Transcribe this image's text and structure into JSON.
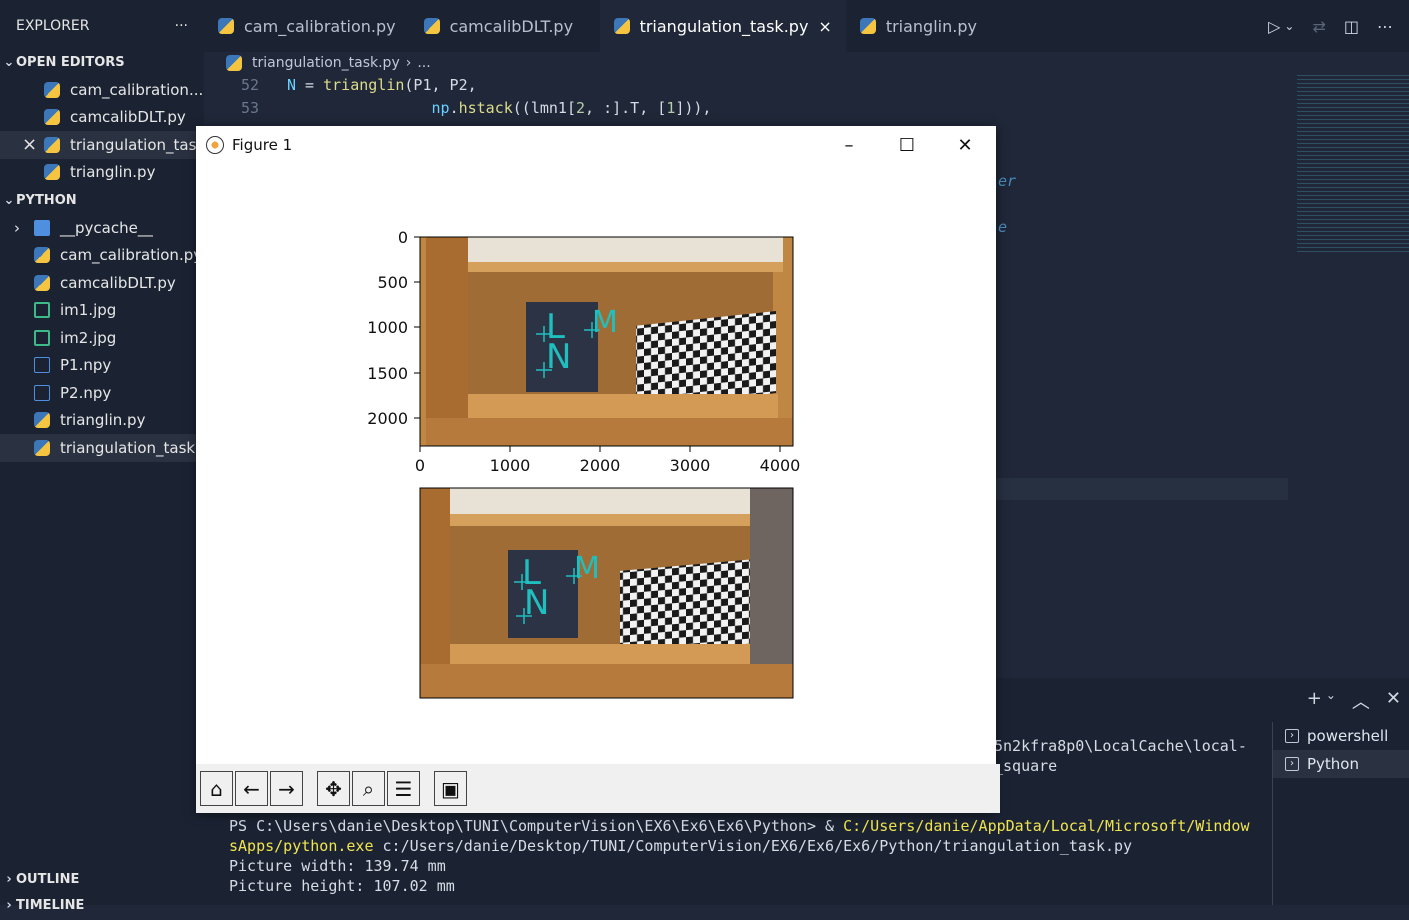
{
  "explorer": {
    "title": "EXPLORER",
    "more": "···",
    "open_editors_title": "OPEN EDITORS",
    "open_editors": [
      {
        "label": "cam_calibration....",
        "icon": "python-icon"
      },
      {
        "label": "camcalibDLT.py",
        "icon": "python-icon"
      },
      {
        "label": "triangulation_tas...",
        "icon": "python-icon",
        "close": "×"
      },
      {
        "label": "trianglin.py",
        "icon": "python-icon"
      }
    ],
    "folder_title": "PYTHON",
    "files": [
      {
        "label": "__pycache__",
        "icon": "folder-icon"
      },
      {
        "label": "cam_calibration.py",
        "icon": "python-icon"
      },
      {
        "label": "camcalibDLT.py",
        "icon": "python-icon"
      },
      {
        "label": "im1.jpg",
        "icon": "image-icon"
      },
      {
        "label": "im2.jpg",
        "icon": "image-icon"
      },
      {
        "label": "P1.npy",
        "icon": "file-icon"
      },
      {
        "label": "P2.npy",
        "icon": "file-icon"
      },
      {
        "label": "trianglin.py",
        "icon": "python-icon"
      },
      {
        "label": "triangulation_task...",
        "icon": "python-icon"
      }
    ],
    "outline": "OUTLINE",
    "timeline": "TIMELINE"
  },
  "tabs": [
    {
      "label": "cam_calibration.py"
    },
    {
      "label": "camcalibDLT.py"
    },
    {
      "label": "triangulation_task.py",
      "close": "×"
    },
    {
      "label": "trianglin.py"
    }
  ],
  "breadcrumb": {
    "file": "triangulation_task.py",
    "rest": "..."
  },
  "code": {
    "line52_num": "52",
    "line52_var": "N",
    "line52_eq": " = ",
    "line52_fn": "trianglin",
    "line52_args": "(P1, P2,",
    "line53_num": "53",
    "line53_mod": "np",
    "line53_dot": ".",
    "line53_fn": "hstack",
    "line53_rest_a": "((lmn1[",
    "line53_n2": "2",
    "line53_rest_b": ", :].T, [",
    "line53_n1": "1",
    "line53_rest_c": "])),",
    "partial_er": "er",
    "partial_e": "e"
  },
  "terminal": {
    "partial1": "5n2kfra8p0\\LocalCache\\local-",
    "partial2": "_square",
    "prompt": "PS C:\\Users\\danie\\Desktop\\TUNI\\ComputerVision\\EX6\\Ex6\\Ex6\\Python> & ",
    "exe_a": "C:/Users/danie/AppData/Local/Microsoft/Window",
    "exe_b": "sApps/python.exe",
    "script": " c:/Users/danie/Desktop/TUNI/ComputerVision/EX6/Ex6/Ex6/Python/triangulation_task.py",
    "out1": "Picture width: 139.74 mm",
    "out2": "Picture height: 107.02 mm",
    "shells": [
      "powershell",
      "Python"
    ]
  },
  "figure": {
    "title": "Figure 1",
    "minimize": "–",
    "maximize": "☐",
    "close": "✕",
    "y_ticks": [
      "0",
      "500",
      "1000",
      "1500",
      "2000"
    ],
    "x_ticks": [
      "0",
      "1000",
      "2000",
      "3000",
      "4000"
    ],
    "annotations": [
      "L",
      "M",
      "N"
    ],
    "annotation_color": "#1fbfbf",
    "toolbar": [
      {
        "name": "home-button",
        "icon": "home-icon"
      },
      {
        "name": "back-button",
        "icon": "arrow-left-icon"
      },
      {
        "name": "forward-button",
        "icon": "arrow-right-icon"
      },
      {
        "name": "pan-button",
        "icon": "move-icon"
      },
      {
        "name": "zoom-button",
        "icon": "magnifier-icon"
      },
      {
        "name": "configure-button",
        "icon": "sliders-icon"
      },
      {
        "name": "save-button",
        "icon": "floppy-icon"
      }
    ]
  }
}
